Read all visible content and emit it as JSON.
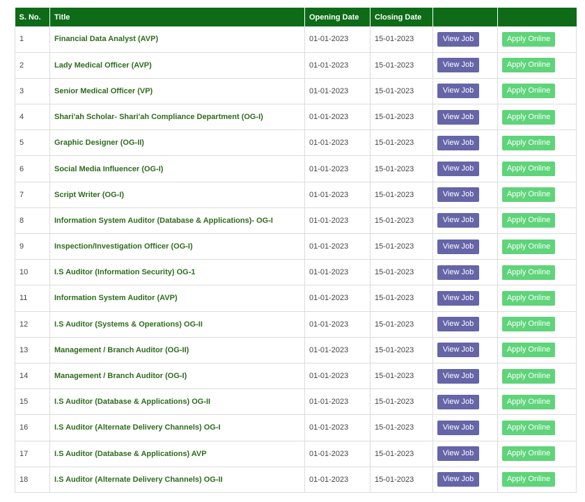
{
  "table": {
    "headers": [
      "S. No.",
      "Title",
      "Opening Date",
      "Closing Date",
      "",
      ""
    ],
    "view_label": "View Job",
    "apply_label": "Apply Online",
    "rows": [
      {
        "no": "1",
        "title": "Financial Data Analyst (AVP)",
        "opening": "01-01-2023",
        "closing": "15-01-2023"
      },
      {
        "no": "2",
        "title": "Lady Medical Officer (AVP)",
        "opening": "01-01-2023",
        "closing": "15-01-2023"
      },
      {
        "no": "3",
        "title": "Senior Medical Officer (VP)",
        "opening": "01-01-2023",
        "closing": "15-01-2023"
      },
      {
        "no": "4",
        "title": "Shari'ah Scholar- Shari'ah Compliance Department (OG-I)",
        "opening": "01-01-2023",
        "closing": "15-01-2023"
      },
      {
        "no": "5",
        "title": "Graphic Designer (OG-II)",
        "opening": "01-01-2023",
        "closing": "15-01-2023"
      },
      {
        "no": "6",
        "title": "Social Media Influencer (OG-I)",
        "opening": "01-01-2023",
        "closing": "15-01-2023"
      },
      {
        "no": "7",
        "title": "Script Writer (OG-I)",
        "opening": "01-01-2023",
        "closing": "15-01-2023"
      },
      {
        "no": "8",
        "title": "Information System Auditor (Database & Applications)- OG-I",
        "opening": "01-01-2023",
        "closing": "15-01-2023"
      },
      {
        "no": "9",
        "title": "Inspection/Investigation Officer (OG-I)",
        "opening": "01-01-2023",
        "closing": "15-01-2023"
      },
      {
        "no": "10",
        "title": "I.S Auditor (Information Security) OG-1",
        "opening": "01-01-2023",
        "closing": "15-01-2023"
      },
      {
        "no": "11",
        "title": "Information System Auditor (AVP)",
        "opening": "01-01-2023",
        "closing": "15-01-2023"
      },
      {
        "no": "12",
        "title": "I.S Auditor (Systems & Operations) OG-II",
        "opening": "01-01-2023",
        "closing": "15-01-2023"
      },
      {
        "no": "13",
        "title": "Management / Branch Auditor (OG-II)",
        "opening": "01-01-2023",
        "closing": "15-01-2023"
      },
      {
        "no": "14",
        "title": "Management / Branch Auditor (OG-I)",
        "opening": "01-01-2023",
        "closing": "15-01-2023"
      },
      {
        "no": "15",
        "title": "I.S Auditor (Database & Applications) OG-II",
        "opening": "01-01-2023",
        "closing": "15-01-2023"
      },
      {
        "no": "16",
        "title": "I.S Auditor (Alternate Delivery Channels) OG-I",
        "opening": "01-01-2023",
        "closing": "15-01-2023"
      },
      {
        "no": "17",
        "title": "I.S Auditor (Database & Applications) AVP",
        "opening": "01-01-2023",
        "closing": "15-01-2023"
      },
      {
        "no": "18",
        "title": "I.S Auditor (Alternate Delivery Channels) OG-II",
        "opening": "01-01-2023",
        "closing": "15-01-2023"
      }
    ]
  },
  "colors": {
    "header_bg": "#0e6b18",
    "view_button": "#6565a8",
    "apply_button": "#5fd47a",
    "title_text": "#2e6b1e"
  }
}
